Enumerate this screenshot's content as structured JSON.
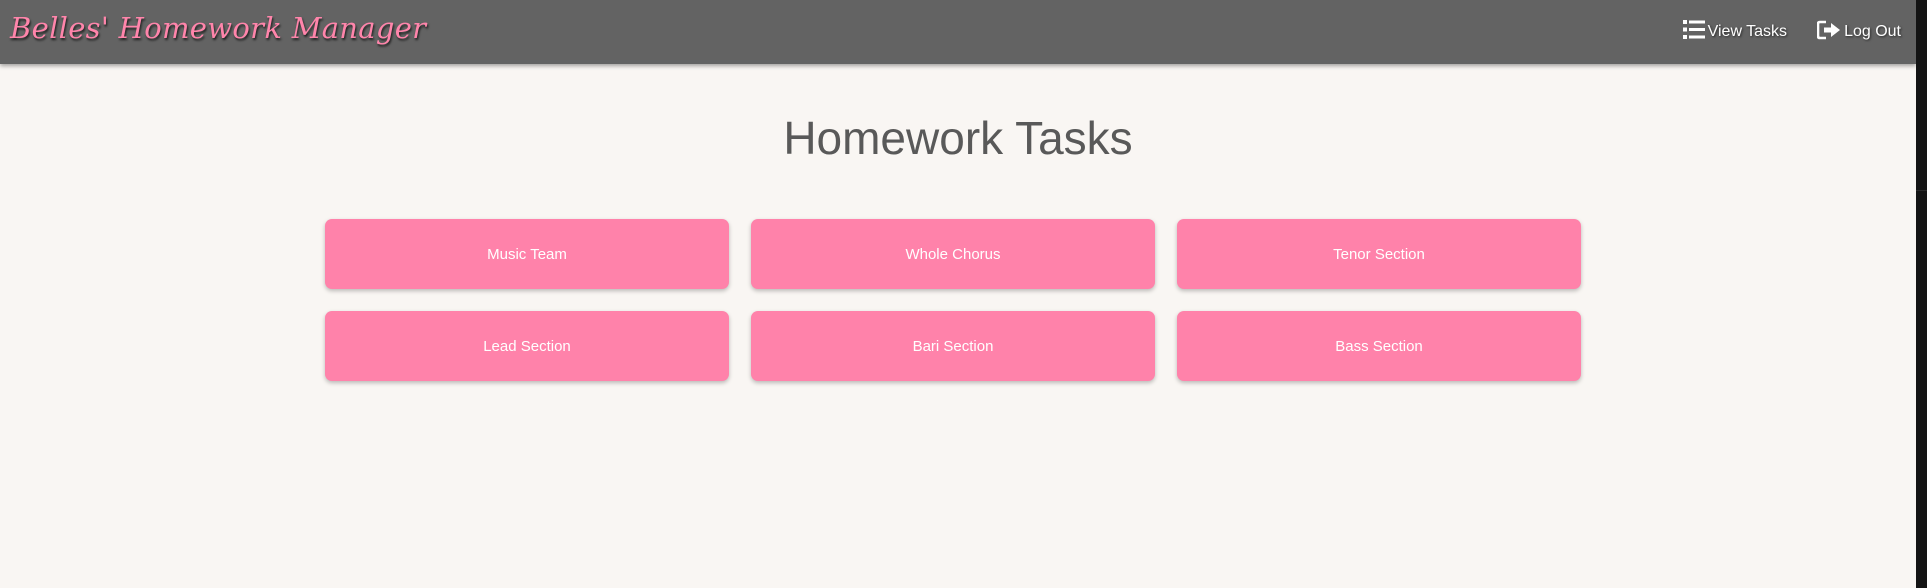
{
  "navbar": {
    "brand": "Belles' Homework Manager",
    "links": [
      {
        "label": "View Tasks",
        "icon": "list-icon"
      },
      {
        "label": "Log Out",
        "icon": "sign-out-icon"
      }
    ]
  },
  "main": {
    "title": "Homework Tasks",
    "sections": [
      {
        "label": "Music Team"
      },
      {
        "label": "Whole Chorus"
      },
      {
        "label": "Tenor Section"
      },
      {
        "label": "Lead Section"
      },
      {
        "label": "Bari Section"
      },
      {
        "label": "Bass Section"
      }
    ]
  },
  "colors": {
    "navbar": "#636363",
    "brand_pink": "#ff85ab",
    "button_pink": "#ff82aa",
    "background": "#f9f6f3",
    "title_text": "#595959"
  }
}
